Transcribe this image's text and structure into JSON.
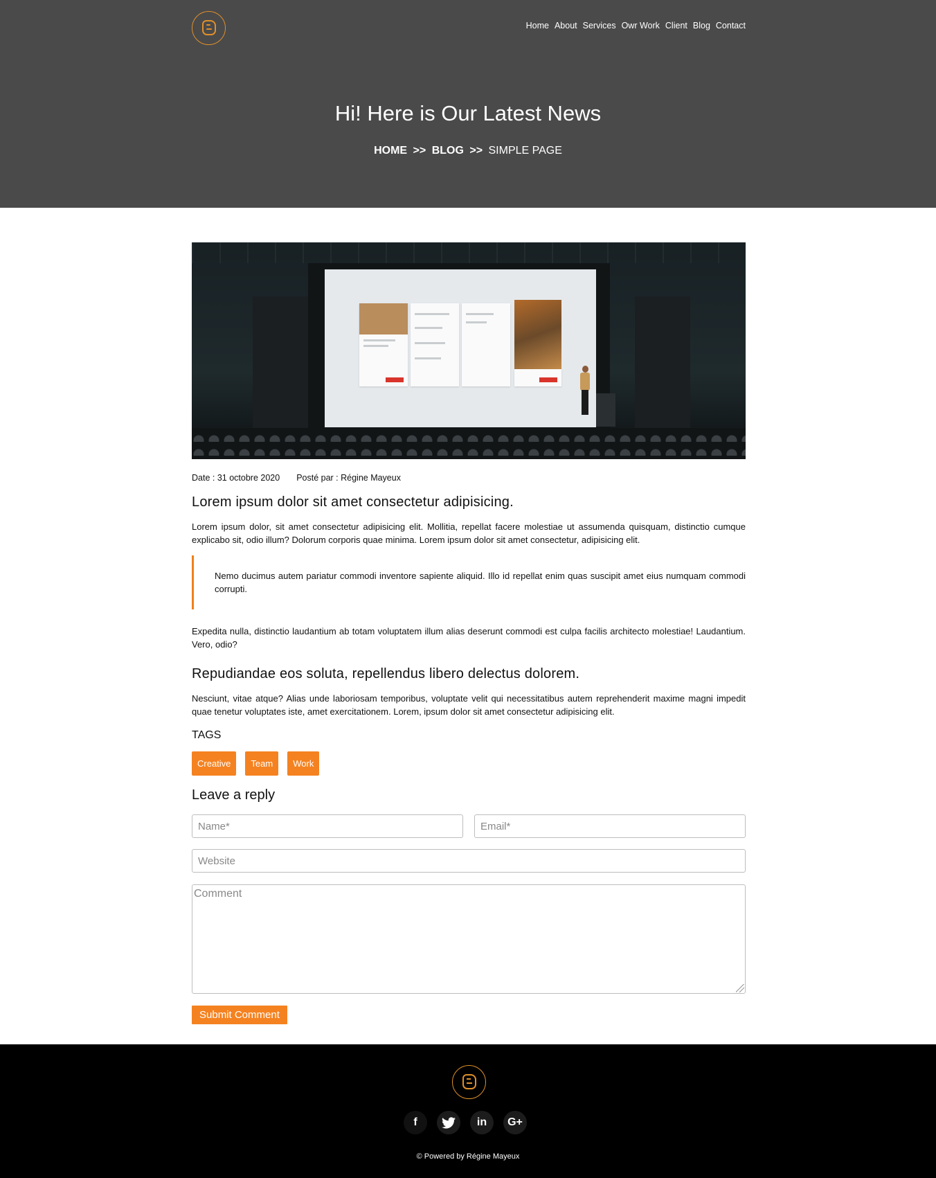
{
  "nav": {
    "items": [
      "Home",
      "About",
      "Services",
      "Owr Work",
      "Client",
      "Blog",
      "Contact"
    ]
  },
  "hero": {
    "title": "Hi! Here is Our Latest News",
    "breadcrumb": {
      "home": "HOME",
      "sep": ">>",
      "blog": "BLOG",
      "current": "SIMPLE PAGE"
    }
  },
  "article": {
    "date": "Date : 31 octobre 2020",
    "author": "Posté par : Régine Mayeux",
    "heading1": "Lorem ipsum dolor sit amet consectetur adipisicing.",
    "para1": "Lorem ipsum dolor, sit amet consectetur adipisicing elit. Mollitia, repellat facere molestiae ut assumenda quisquam, distinctio cumque explicabo sit, odio illum? Dolorum corporis quae minima. Lorem ipsum dolor sit amet consectetur, adipisicing elit.",
    "quote": "Nemo ducimus autem pariatur commodi inventore sapiente aliquid. Illo id repellat enim quas suscipit amet eius numquam commodi corrupti.",
    "para2": "Expedita nulla, distinctio laudantium ab totam voluptatem illum alias deserunt commodi est culpa facilis architecto molestiae! Laudantium. Vero, odio?",
    "heading2": "Repudiandae eos soluta, repellendus libero delectus dolorem.",
    "para3": "Nesciunt, vitae atque? Alias unde laboriosam temporibus, voluptate velit qui necessitatibus autem reprehenderit maxime magni impedit quae tenetur voluptates iste, amet exercitationem. Lorem, ipsum dolor sit amet consectetur adipisicing elit."
  },
  "tags": {
    "title": "TAGS",
    "items": [
      "Creative",
      "Team",
      "Work"
    ]
  },
  "reply": {
    "title": "Leave a reply",
    "name_placeholder": "Name*",
    "email_placeholder": "Email*",
    "website_placeholder": "Website",
    "comment_placeholder": "Comment",
    "submit_label": "Submit Comment"
  },
  "footer": {
    "socials": [
      {
        "icon": "facebook-icon",
        "glyph": "f"
      },
      {
        "icon": "twitter-icon",
        "glyph": "🐦"
      },
      {
        "icon": "linkedin-icon",
        "glyph": "in"
      },
      {
        "icon": "google-plus-icon",
        "glyph": "G+"
      }
    ],
    "copyright": "© Powered by Régine Mayeux"
  },
  "colors": {
    "accent": "#f58220",
    "header_bg": "#4a4a4a",
    "footer_bg": "#000000",
    "logo": "#e0902b"
  }
}
